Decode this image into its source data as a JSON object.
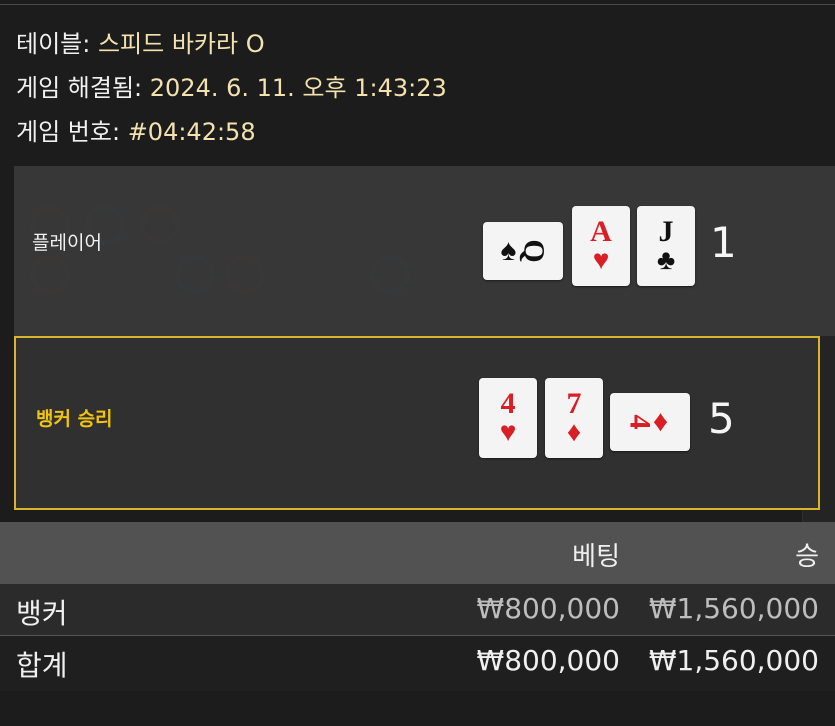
{
  "header": {
    "table_label": "테이블:",
    "table_value": "스피드 바카라 O",
    "resolved_label": "게임 해결됨:",
    "resolved_value": "2024. 6. 11. 오후 1:43:23",
    "game_no_label": "게임 번호:",
    "game_no_value": "#04:42:58"
  },
  "player": {
    "label": "플레이어",
    "score": "1",
    "cards": [
      {
        "rank": "Q",
        "suit": "♠",
        "color": "black",
        "orientation": "horizontal"
      },
      {
        "rank": "A",
        "suit": "♥",
        "color": "red",
        "orientation": "vertical"
      },
      {
        "rank": "J",
        "suit": "♣",
        "color": "black",
        "orientation": "vertical"
      }
    ]
  },
  "banker": {
    "label": "뱅커 승리",
    "score": "5",
    "cards": [
      {
        "rank": "4",
        "suit": "♥",
        "color": "red",
        "orientation": "vertical"
      },
      {
        "rank": "7",
        "suit": "♦",
        "color": "red",
        "orientation": "vertical"
      },
      {
        "rank": "4",
        "suit": "♦",
        "color": "red",
        "orientation": "horizontal"
      }
    ]
  },
  "results": {
    "col_bet": "베팅",
    "col_win": "승",
    "rows": [
      {
        "name": "뱅커",
        "bet": "₩800,000",
        "win": "₩1,560,000"
      }
    ],
    "total": {
      "name": "합계",
      "bet": "₩800,000",
      "win": "₩1,560,000"
    }
  },
  "colors": {
    "accent": "#d8b52c",
    "banker_label": "#f1c40f",
    "value_text": "#f3e2b0"
  }
}
